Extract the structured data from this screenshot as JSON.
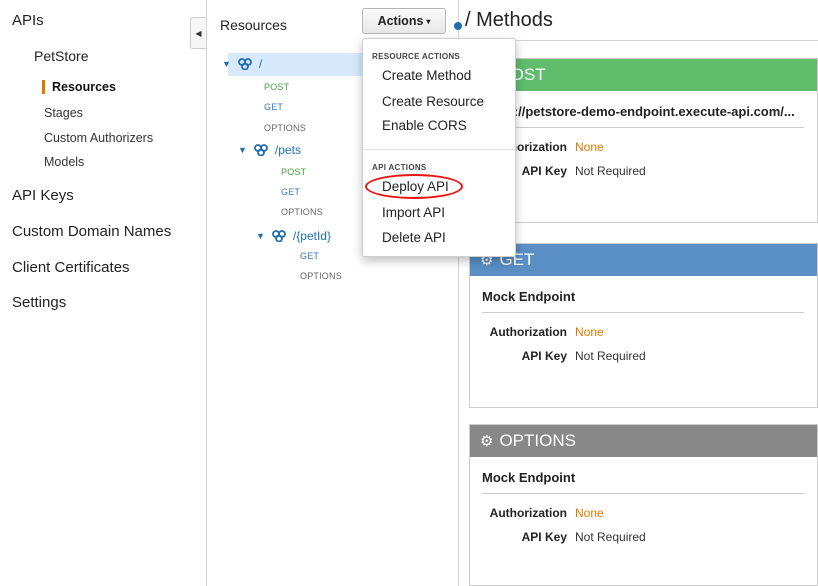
{
  "nav": {
    "apis": "APIs",
    "petstore": "PetStore",
    "sub_items": [
      "Resources",
      "Stages",
      "Custom Authorizers",
      "Models"
    ],
    "top_items": [
      "API Keys",
      "Custom Domain Names",
      "Client Certificates",
      "Settings"
    ]
  },
  "resources": {
    "title": "Resources",
    "tree": {
      "root": "/",
      "root_methods": [
        "POST",
        "GET",
        "OPTIONS"
      ],
      "pets": "/pets",
      "pets_methods": [
        "POST",
        "GET",
        "OPTIONS"
      ],
      "petid": "/{petId}",
      "petid_methods": [
        "GET",
        "OPTIONS"
      ]
    }
  },
  "actions": {
    "button_label": "Actions",
    "menu": {
      "resource_section": "RESOURCE ACTIONS",
      "resource_items": [
        "Create Method",
        "Create Resource",
        "Enable CORS"
      ],
      "api_section": "API ACTIONS",
      "api_items": [
        "Deploy API",
        "Import API",
        "Delete API"
      ]
    }
  },
  "methods": {
    "title": "/ Methods",
    "cards": [
      {
        "method": "POST",
        "endpoint": "https://petstore-demo-endpoint.execute-api.com/...",
        "auth_label": "Authorization",
        "auth_value": "None",
        "key_label": "API Key",
        "key_value": "Not Required"
      },
      {
        "method": "GET",
        "endpoint": "Mock Endpoint",
        "auth_label": "Authorization",
        "auth_value": "None",
        "key_label": "API Key",
        "key_value": "Not Required"
      },
      {
        "method": "OPTIONS",
        "endpoint": "Mock Endpoint",
        "auth_label": "Authorization",
        "auth_value": "None",
        "key_label": "API Key",
        "key_value": "Not Required"
      }
    ]
  },
  "colors": {
    "post": "#5fbd6b",
    "get": "#5a8fc5",
    "options": "#888888",
    "accent_orange": "#e07b00",
    "link_blue": "#1f6fb2",
    "highlight_ring": "#ee1111"
  }
}
